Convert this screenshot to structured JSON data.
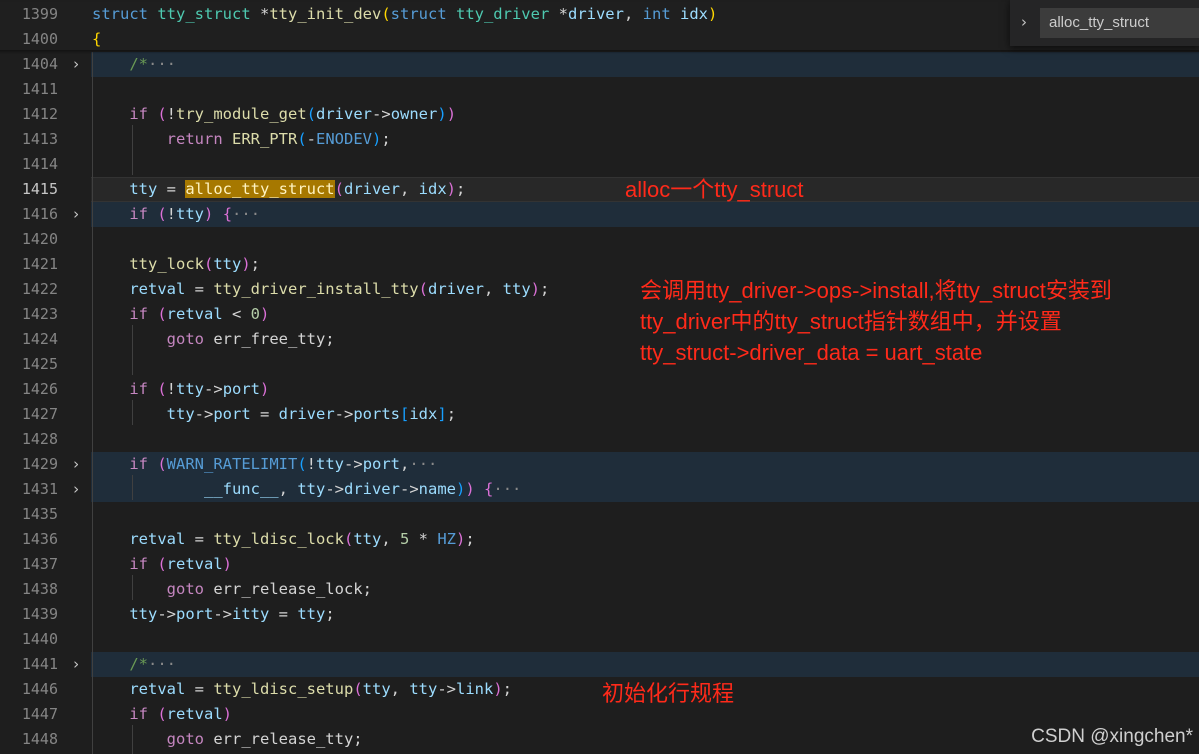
{
  "find": {
    "value": "alloc_tty_struct",
    "toggle_glyph": "›"
  },
  "lines": [
    {
      "num": "1399",
      "fold": "",
      "sticky": true,
      "tokens": [
        [
          "kw",
          "struct "
        ],
        [
          "typ",
          "tty_struct"
        ],
        [
          "plain",
          " *"
        ],
        [
          "fn",
          "tty_init_dev"
        ],
        [
          "b1",
          "("
        ],
        [
          "kw",
          "struct "
        ],
        [
          "typ",
          "tty_driver"
        ],
        [
          "plain",
          " *"
        ],
        [
          "var",
          "driver"
        ],
        [
          "plain",
          ", "
        ],
        [
          "kw",
          "int "
        ],
        [
          "var",
          "idx"
        ],
        [
          "b1",
          ")"
        ]
      ]
    },
    {
      "num": "1400",
      "fold": "",
      "sticky": true,
      "tokens": [
        [
          "b1",
          "{"
        ]
      ]
    },
    {
      "num": "1404",
      "fold": "›",
      "folded": true,
      "tokens": [
        [
          "cmt",
          "    /*"
        ],
        [
          "dots",
          "···"
        ]
      ]
    },
    {
      "num": "1411",
      "fold": "",
      "tokens": []
    },
    {
      "num": "1412",
      "fold": "",
      "tokens": [
        [
          "ctl",
          "    if "
        ],
        [
          "b2",
          "("
        ],
        [
          "plain",
          "!"
        ],
        [
          "fn",
          "try_module_get"
        ],
        [
          "b3",
          "("
        ],
        [
          "var",
          "driver"
        ],
        [
          "plain",
          "->"
        ],
        [
          "var",
          "owner"
        ],
        [
          "b3",
          ")"
        ],
        [
          "b2",
          ")"
        ]
      ]
    },
    {
      "num": "1413",
      "fold": "",
      "tokens": [
        [
          "ctl",
          "        return "
        ],
        [
          "fn",
          "ERR_PTR"
        ],
        [
          "b3",
          "("
        ],
        [
          "plain",
          "-"
        ],
        [
          "mac",
          "ENODEV"
        ],
        [
          "b3",
          ")"
        ],
        [
          "plain",
          ";"
        ]
      ]
    },
    {
      "num": "1414",
      "fold": "",
      "tokens": []
    },
    {
      "num": "1415",
      "fold": "",
      "current": true,
      "tokens": [
        [
          "var",
          "    tty"
        ],
        [
          "plain",
          " = "
        ],
        [
          "hl",
          "alloc_tty_struct"
        ],
        [
          "b2",
          "("
        ],
        [
          "var",
          "driver"
        ],
        [
          "plain",
          ", "
        ],
        [
          "var",
          "idx"
        ],
        [
          "b2",
          ")"
        ],
        [
          "plain",
          ";"
        ]
      ]
    },
    {
      "num": "1416",
      "fold": "›",
      "folded": true,
      "tokens": [
        [
          "ctl",
          "    if "
        ],
        [
          "b2",
          "("
        ],
        [
          "plain",
          "!"
        ],
        [
          "var",
          "tty"
        ],
        [
          "b2",
          ")"
        ],
        [
          "plain",
          " "
        ],
        [
          "b2",
          "{"
        ],
        [
          "dots",
          "···"
        ]
      ]
    },
    {
      "num": "1420",
      "fold": "",
      "tokens": []
    },
    {
      "num": "1421",
      "fold": "",
      "tokens": [
        [
          "fn",
          "    tty_lock"
        ],
        [
          "b2",
          "("
        ],
        [
          "var",
          "tty"
        ],
        [
          "b2",
          ")"
        ],
        [
          "plain",
          ";"
        ]
      ]
    },
    {
      "num": "1422",
      "fold": "",
      "tokens": [
        [
          "var",
          "    retval"
        ],
        [
          "plain",
          " = "
        ],
        [
          "fn",
          "tty_driver_install_tty"
        ],
        [
          "b2",
          "("
        ],
        [
          "var",
          "driver"
        ],
        [
          "plain",
          ", "
        ],
        [
          "var",
          "tty"
        ],
        [
          "b2",
          ")"
        ],
        [
          "plain",
          ";"
        ]
      ]
    },
    {
      "num": "1423",
      "fold": "",
      "tokens": [
        [
          "ctl",
          "    if "
        ],
        [
          "b2",
          "("
        ],
        [
          "var",
          "retval"
        ],
        [
          "plain",
          " < "
        ],
        [
          "num",
          "0"
        ],
        [
          "b2",
          ")"
        ]
      ]
    },
    {
      "num": "1424",
      "fold": "",
      "tokens": [
        [
          "ctl",
          "        goto "
        ],
        [
          "plain",
          "err_free_tty;"
        ]
      ]
    },
    {
      "num": "1425",
      "fold": "",
      "tokens": []
    },
    {
      "num": "1426",
      "fold": "",
      "tokens": [
        [
          "ctl",
          "    if "
        ],
        [
          "b2",
          "("
        ],
        [
          "plain",
          "!"
        ],
        [
          "var",
          "tty"
        ],
        [
          "plain",
          "->"
        ],
        [
          "var",
          "port"
        ],
        [
          "b2",
          ")"
        ]
      ]
    },
    {
      "num": "1427",
      "fold": "",
      "tokens": [
        [
          "var",
          "        tty"
        ],
        [
          "plain",
          "->"
        ],
        [
          "var",
          "port"
        ],
        [
          "plain",
          " = "
        ],
        [
          "var",
          "driver"
        ],
        [
          "plain",
          "->"
        ],
        [
          "var",
          "ports"
        ],
        [
          "b3",
          "["
        ],
        [
          "var",
          "idx"
        ],
        [
          "b3",
          "]"
        ],
        [
          "plain",
          ";"
        ]
      ]
    },
    {
      "num": "1428",
      "fold": "",
      "tokens": []
    },
    {
      "num": "1429",
      "fold": "›",
      "folded": true,
      "tokens": [
        [
          "ctl",
          "    if "
        ],
        [
          "b2",
          "("
        ],
        [
          "mac",
          "WARN_RATELIMIT"
        ],
        [
          "b3",
          "("
        ],
        [
          "plain",
          "!"
        ],
        [
          "var",
          "tty"
        ],
        [
          "plain",
          "->"
        ],
        [
          "var",
          "port"
        ],
        [
          "plain",
          ","
        ],
        [
          "dots",
          "···"
        ]
      ]
    },
    {
      "num": "1431",
      "fold": "›",
      "folded": true,
      "tokens": [
        [
          "var",
          "            __func__"
        ],
        [
          "plain",
          ", "
        ],
        [
          "var",
          "tty"
        ],
        [
          "plain",
          "->"
        ],
        [
          "var",
          "driver"
        ],
        [
          "plain",
          "->"
        ],
        [
          "var",
          "name"
        ],
        [
          "b3",
          ")"
        ],
        [
          "b2",
          ")"
        ],
        [
          "plain",
          " "
        ],
        [
          "b2",
          "{"
        ],
        [
          "dots",
          "···"
        ]
      ]
    },
    {
      "num": "1435",
      "fold": "",
      "tokens": []
    },
    {
      "num": "1436",
      "fold": "",
      "tokens": [
        [
          "var",
          "    retval"
        ],
        [
          "plain",
          " = "
        ],
        [
          "fn",
          "tty_ldisc_lock"
        ],
        [
          "b2",
          "("
        ],
        [
          "var",
          "tty"
        ],
        [
          "plain",
          ", "
        ],
        [
          "num",
          "5"
        ],
        [
          "plain",
          " * "
        ],
        [
          "mac",
          "HZ"
        ],
        [
          "b2",
          ")"
        ],
        [
          "plain",
          ";"
        ]
      ]
    },
    {
      "num": "1437",
      "fold": "",
      "tokens": [
        [
          "ctl",
          "    if "
        ],
        [
          "b2",
          "("
        ],
        [
          "var",
          "retval"
        ],
        [
          "b2",
          ")"
        ]
      ]
    },
    {
      "num": "1438",
      "fold": "",
      "tokens": [
        [
          "ctl",
          "        goto "
        ],
        [
          "plain",
          "err_release_lock;"
        ]
      ]
    },
    {
      "num": "1439",
      "fold": "",
      "tokens": [
        [
          "var",
          "    tty"
        ],
        [
          "plain",
          "->"
        ],
        [
          "var",
          "port"
        ],
        [
          "plain",
          "->"
        ],
        [
          "var",
          "itty"
        ],
        [
          "plain",
          " = "
        ],
        [
          "var",
          "tty"
        ],
        [
          "plain",
          ";"
        ]
      ]
    },
    {
      "num": "1440",
      "fold": "",
      "tokens": []
    },
    {
      "num": "1441",
      "fold": "›",
      "folded": true,
      "tokens": [
        [
          "cmt",
          "    /*"
        ],
        [
          "dots",
          "···"
        ]
      ]
    },
    {
      "num": "1446",
      "fold": "",
      "tokens": [
        [
          "var",
          "    retval"
        ],
        [
          "plain",
          " = "
        ],
        [
          "fn",
          "tty_ldisc_setup"
        ],
        [
          "b2",
          "("
        ],
        [
          "var",
          "tty"
        ],
        [
          "plain",
          ", "
        ],
        [
          "var",
          "tty"
        ],
        [
          "plain",
          "->"
        ],
        [
          "var",
          "link"
        ],
        [
          "b2",
          ")"
        ],
        [
          "plain",
          ";"
        ]
      ]
    },
    {
      "num": "1447",
      "fold": "",
      "tokens": [
        [
          "ctl",
          "    if "
        ],
        [
          "b2",
          "("
        ],
        [
          "var",
          "retval"
        ],
        [
          "b2",
          ")"
        ]
      ]
    },
    {
      "num": "1448",
      "fold": "",
      "tokens": [
        [
          "ctl",
          "        goto "
        ],
        [
          "plain",
          "err_release_tty;"
        ]
      ]
    }
  ],
  "annotations": {
    "a1": "alloc一个tty_struct",
    "a2": "会调用tty_driver->ops->install,将tty_struct安装到\ntty_driver中的tty_struct指针数组中，并设置\ntty_struct->driver_data = uart_state",
    "a3": "初始化行规程"
  },
  "watermark": "CSDN @xingchen*",
  "colors": {
    "background": "#1e1e1e",
    "annotation": "#ff2a1a",
    "find_highlight": "#a67800"
  }
}
